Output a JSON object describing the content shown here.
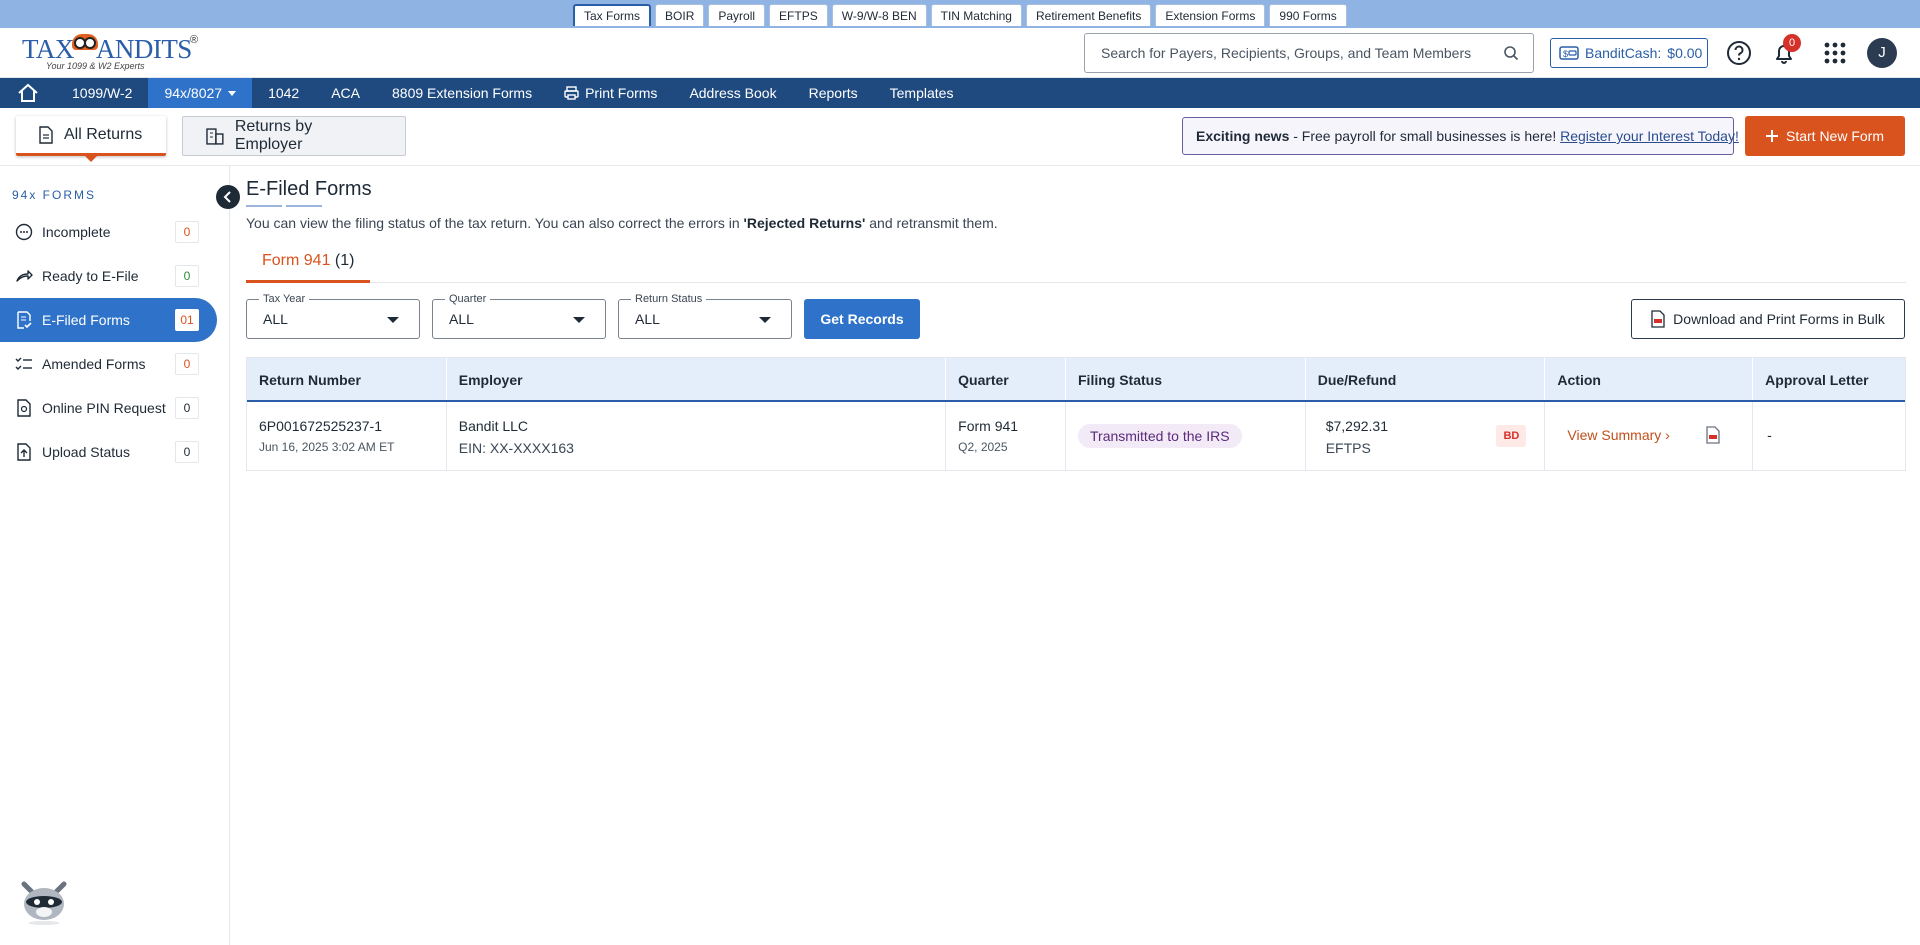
{
  "product_tabs": [
    "Tax Forms",
    "BOIR",
    "Payroll",
    "EFTPS",
    "W-9/W-8 BEN",
    "TIN Matching",
    "Retirement Benefits",
    "Extension Forms",
    "990 Forms"
  ],
  "logo": {
    "text_left": "TAX",
    "text_right": "ANDITS",
    "reg": "®",
    "tagline": "Your 1099 & W2 Experts"
  },
  "search": {
    "placeholder": "Search for Payers, Recipients, Groups, and Team Members"
  },
  "bandit_cash": {
    "label": "BanditCash:",
    "value": "$0.00"
  },
  "notifications": {
    "count": "0"
  },
  "user": {
    "initial": "J"
  },
  "nav": [
    "1099/W-2",
    "94x/8027",
    "1042",
    "ACA",
    "8809 Extension Forms",
    "Print Forms",
    "Address Book",
    "Reports",
    "Templates"
  ],
  "subtabs": {
    "all": "All Returns",
    "employer": "Returns by Employer"
  },
  "news": {
    "bold": "Exciting news",
    "text": " - Free payroll for small businesses is here! ",
    "link": "Register your Interest Today!"
  },
  "start_button": "Start New Form",
  "sidebar": {
    "title": "94x FORMS",
    "items": [
      {
        "label": "Incomplete",
        "count": "0"
      },
      {
        "label": "Ready to E-File",
        "count": "0"
      },
      {
        "label": "E-Filed Forms",
        "count": "01"
      },
      {
        "label": "Amended Forms",
        "count": "0"
      },
      {
        "label": "Online PIN Request",
        "count": "0"
      },
      {
        "label": "Upload Status",
        "count": "0"
      }
    ]
  },
  "page": {
    "title": "E-Filed Forms",
    "desc_1": "You can view the filing status of the tax return. You can also correct the errors in ",
    "desc_bold": "'Rejected Returns'",
    "desc_2": " and retransmit them.",
    "form_tab": "Form 941",
    "form_tab_count": " (1)"
  },
  "filters": {
    "tax_year": {
      "label": "Tax Year",
      "value": "ALL"
    },
    "quarter": {
      "label": "Quarter",
      "value": "ALL"
    },
    "status": {
      "label": "Return Status",
      "value": "ALL"
    },
    "get_records": "Get Records",
    "bulk": "Download and Print Forms in Bulk"
  },
  "table": {
    "headers": [
      "Return Number",
      "Employer",
      "Quarter",
      "Filing Status",
      "Due/Refund",
      "Action",
      "Approval Letter"
    ],
    "rows": [
      {
        "return_number": "6P001672525237-1",
        "date": "Jun 16, 2025 3:02 AM ET",
        "employer": "Bandit LLC",
        "ein": "EIN: XX-XXXX163",
        "form": "Form 941",
        "quarter": "Q2, 2025",
        "status": "Transmitted to the IRS",
        "amount": "$7,292.31",
        "method": "EFTPS",
        "badge": "BD",
        "action": "View Summary",
        "approval": "-"
      }
    ]
  },
  "colors": {
    "brand_blue": "#1f4a80",
    "accent_blue": "#2e73c9",
    "accent_orange": "#d9531e"
  }
}
